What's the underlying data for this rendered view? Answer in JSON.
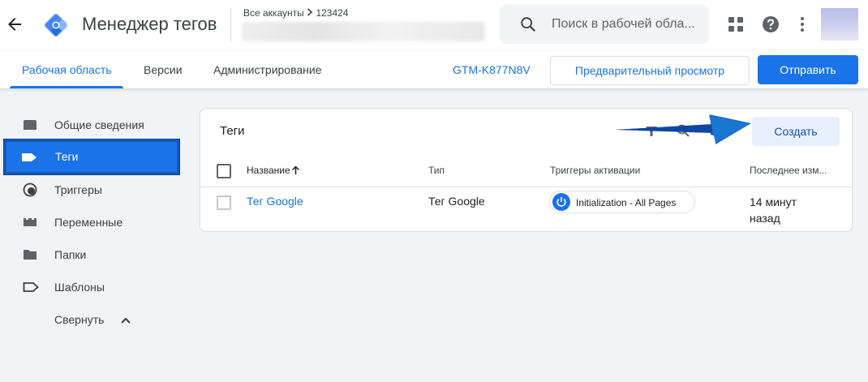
{
  "header": {
    "app_title": "Менеджер тегов",
    "accounts_label": "Все аккаунты",
    "account_id": "123424",
    "search_placeholder": "Поиск в рабочей обла..."
  },
  "subnav": {
    "tabs": [
      {
        "label": "Рабочая область",
        "active": true
      },
      {
        "label": "Версии",
        "active": false
      },
      {
        "label": "Администрирование",
        "active": false
      }
    ],
    "container_id": "GTM-K877N8V",
    "preview_label": "Предварительный просмотр",
    "submit_label": "Отправить"
  },
  "sidebar": {
    "items": [
      {
        "label": "Общие сведения",
        "icon": "overview-icon"
      },
      {
        "label": "Теги",
        "icon": "tag-icon",
        "selected": true
      },
      {
        "label": "Триггеры",
        "icon": "trigger-icon"
      },
      {
        "label": "Переменные",
        "icon": "variables-icon"
      },
      {
        "label": "Папки",
        "icon": "folder-icon"
      },
      {
        "label": "Шаблоны",
        "icon": "template-icon"
      }
    ],
    "collapse_label": "Свернуть"
  },
  "tags_card": {
    "title": "Теги",
    "create_label": "Создать",
    "columns": [
      "Название",
      "Тип",
      "Триггеры активации",
      "Последнее изм..."
    ],
    "rows": [
      {
        "name": "Тег Google",
        "type": "Тег Google",
        "trigger": "Initialization - All Pages",
        "modified_line1": "14 минут",
        "modified_line2": "назад"
      }
    ]
  },
  "colors": {
    "accent": "#1a73e8",
    "selected_border": "#1259b8",
    "create_bg": "#e8f0fe"
  }
}
